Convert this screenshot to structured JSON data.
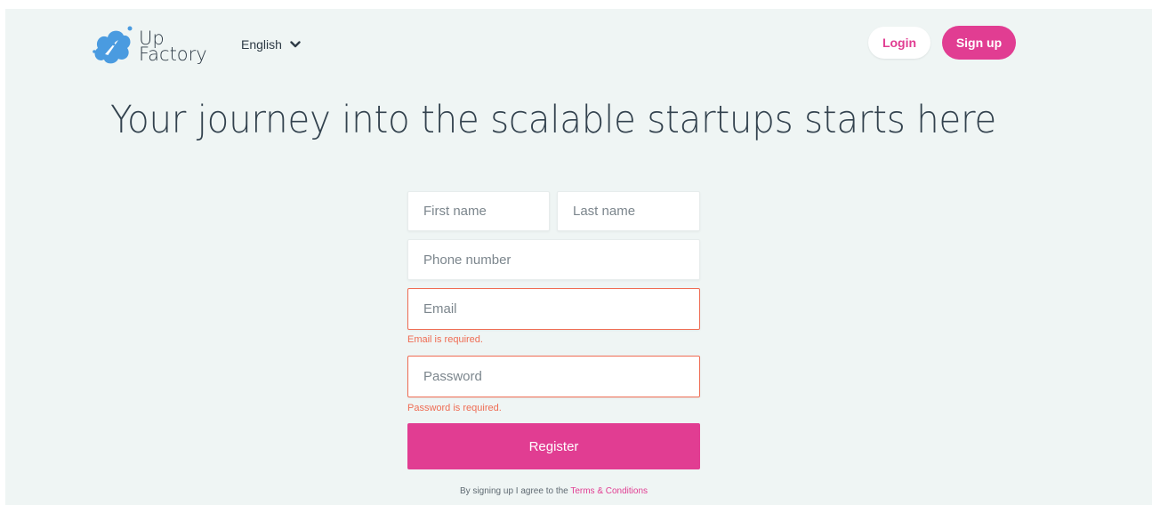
{
  "brand": {
    "line1": "Up",
    "line2": "Factory",
    "logo_color": "#4a9be0"
  },
  "header": {
    "language": "English",
    "login_label": "Login",
    "signup_label": "Sign up"
  },
  "headline": "Your journey into the scalable startups starts here",
  "form": {
    "first_name_placeholder": "First name",
    "last_name_placeholder": "Last name",
    "phone_placeholder": "Phone number",
    "email_placeholder": "Email",
    "email_error": "Email is required.",
    "password_placeholder": "Password",
    "password_error": "Password is required.",
    "register_label": "Register",
    "terms_prefix": "By signing up I agree to the ",
    "terms_link": "Terms & Conditions"
  },
  "colors": {
    "accent": "#e13d92",
    "error": "#ef6c53",
    "background": "#eff5f4"
  }
}
